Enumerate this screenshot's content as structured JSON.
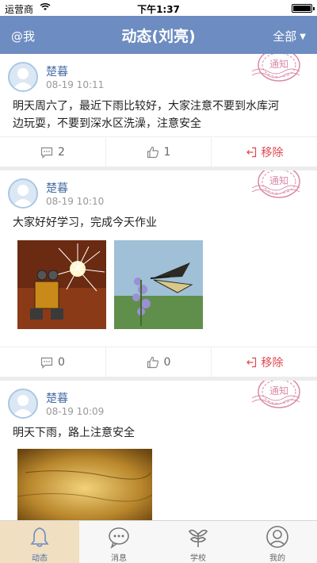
{
  "status_bar": {
    "carrier": "运营商",
    "time": "下午1:37"
  },
  "nav": {
    "left": "@我",
    "title": "动态(刘亮)",
    "right": "全部",
    "caret": "▼"
  },
  "stamp_text": "通知",
  "posts": [
    {
      "author": "楚暮",
      "time": "08-19 10:11",
      "text_lines": [
        "明天周六了，最近下雨比较好，大家注意不要到水库河",
        "边玩耍，不要到深水区洗澡，注意安全"
      ],
      "comments": "2",
      "likes": "1",
      "remove_label": "移除"
    },
    {
      "author": "楚暮",
      "time": "08-19 10:10",
      "text_lines": [
        "大家好好学习，完成今天作业"
      ],
      "images": [
        "robot-sparkler-photo",
        "butterfly-flower-photo"
      ],
      "comments": "0",
      "likes": "0",
      "remove_label": "移除"
    },
    {
      "author": "楚暮",
      "time": "08-19 10:09",
      "text_lines": [
        "明天下雨，路上注意安全"
      ],
      "images": [
        "golden-texture-photo"
      ]
    }
  ],
  "tabs": [
    {
      "label": "动态",
      "icon": "bell-icon",
      "active": true
    },
    {
      "label": "消息",
      "icon": "chat-bubble-icon",
      "active": false
    },
    {
      "label": "学校",
      "icon": "plant-icon",
      "active": false
    },
    {
      "label": "我的",
      "icon": "person-icon",
      "active": false
    }
  ],
  "colors": {
    "nav": "#6d8cc1",
    "author": "#4a6fa5",
    "remove": "#e0474c",
    "stamp": "#d98aa8",
    "active_tab": "#f0dfc0"
  }
}
